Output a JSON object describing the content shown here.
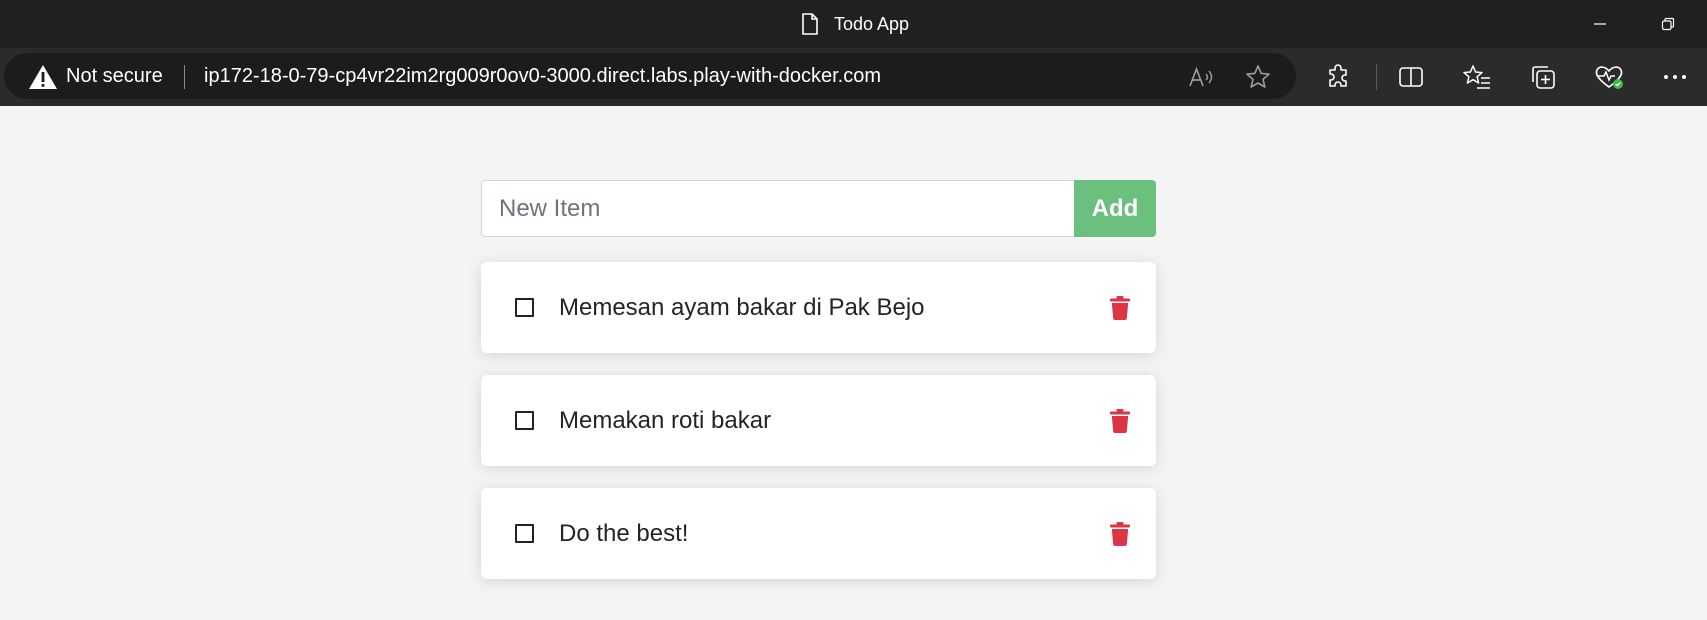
{
  "window": {
    "title": "Todo App"
  },
  "browser": {
    "security_label": "Not secure",
    "url": "ip172-18-0-79-cp4vr22im2rg009r0ov0-3000.direct.labs.play-with-docker.com"
  },
  "todo": {
    "input_placeholder": "New Item",
    "add_label": "Add",
    "items": [
      {
        "label": "Memesan ayam bakar di Pak Bejo",
        "checked": false
      },
      {
        "label": "Memakan roti bakar",
        "checked": false
      },
      {
        "label": "Do the best!",
        "checked": false
      }
    ]
  },
  "colors": {
    "add_button": "#6cc07d",
    "delete_icon": "#dc3545",
    "titlebar": "#202020",
    "page_background": "#f4f4f4"
  }
}
